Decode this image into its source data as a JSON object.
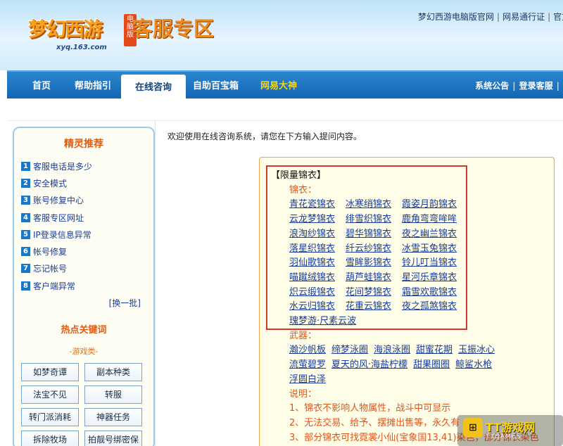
{
  "header": {
    "logo_text": "梦幻西游",
    "logo_badge": "电脑版",
    "logo_url": "xyq.163.com",
    "section_title": "客服专区",
    "top_links": [
      "梦幻西游电脑版官网",
      "网易通行证",
      "官方"
    ]
  },
  "nav": {
    "tabs": [
      {
        "label": "首页"
      },
      {
        "label": "帮助指引"
      },
      {
        "label": "在线咨询"
      },
      {
        "label": "自助百宝箱"
      },
      {
        "label": "网易大神"
      }
    ],
    "right_links": [
      "系统公告",
      "登录客服"
    ]
  },
  "sidebar": {
    "title": "精灵推荐",
    "items": [
      {
        "num": "1",
        "label": "客服电话是多少"
      },
      {
        "num": "2",
        "label": "安全模式"
      },
      {
        "num": "3",
        "label": "账号修复中心"
      },
      {
        "num": "4",
        "label": "客服专区网址"
      },
      {
        "num": "5",
        "label": "IP登录信息异常"
      },
      {
        "num": "6",
        "label": "帐号修复"
      },
      {
        "num": "7",
        "label": "忘记帐号"
      },
      {
        "num": "8",
        "label": "客户端异常"
      }
    ],
    "swap": "[换一批]",
    "hot_title": "热点关键词",
    "hot_sub": "-游戏类-",
    "keywords": [
      "如梦奇谭",
      "副本种类",
      "法宝不见",
      "转服",
      "转门派消耗",
      "神器任务",
      "拆除牧场",
      "拍靓号绑密保"
    ]
  },
  "main": {
    "welcome": "欢迎使用在线咨询系统，请您在下方输入提问内容。",
    "head": "【限量锦衣】",
    "jinyi_label": "锦衣：",
    "jinyi_rows": [
      [
        "青花瓷锦衣",
        "冰寒绡锦衣",
        "霞姿月韵锦衣"
      ],
      [
        "云龙梦锦衣",
        "绯雪织锦衣",
        "鹿角弯弯哞哞"
      ],
      [
        "浪淘纱锦衣",
        "碧华锦锦衣",
        "夜之幽兰锦衣"
      ],
      [
        "落星织锦衣",
        "纤云纱锦衣",
        "冰雪玉兔锦衣"
      ],
      [
        "羽仙歌锦衣",
        "雪眸影锦衣",
        "铃儿叮当锦衣"
      ],
      [
        "喵蹴绒锦衣",
        "葫芦蛙锦衣",
        "星河乐章锦衣"
      ],
      [
        "炽云缎锦衣",
        "花间梦锦衣",
        "霜雪欢歌锦衣"
      ],
      [
        "水云归锦衣",
        "花重云锦衣",
        "夜之孤煞锦衣"
      ],
      [
        "瑰梦游·尺素云波"
      ]
    ],
    "weapon_label": "武器：",
    "weapon_rows": [
      [
        "瀚沙帆板",
        "缔梦泳圈",
        "海浪泳圈",
        "甜蜜花期",
        "玉振冰心"
      ],
      [
        "流萤碧罗",
        "夏天的风·海盐柠檬",
        "甜果圈圈",
        "鲸鲨水枪"
      ],
      [
        "浮圆白泽"
      ]
    ],
    "note_label": "说明：",
    "notes": [
      "1、锦衣不影响人物属性，战斗中可显示",
      "2、无法交易、给予、摆摊出售等，永久有",
      "3、部分锦衣可找霓裳小仙(宝象国13,41)染色，部分锦衣染色"
    ]
  },
  "watermark": {
    "text": "TT游戏网",
    "sub": "TTGAMES"
  },
  "colors": {
    "nav": "#1a6fbe",
    "accent": "#e0541a",
    "highlight_border": "#d8332e",
    "link": "#1a3c9a"
  }
}
